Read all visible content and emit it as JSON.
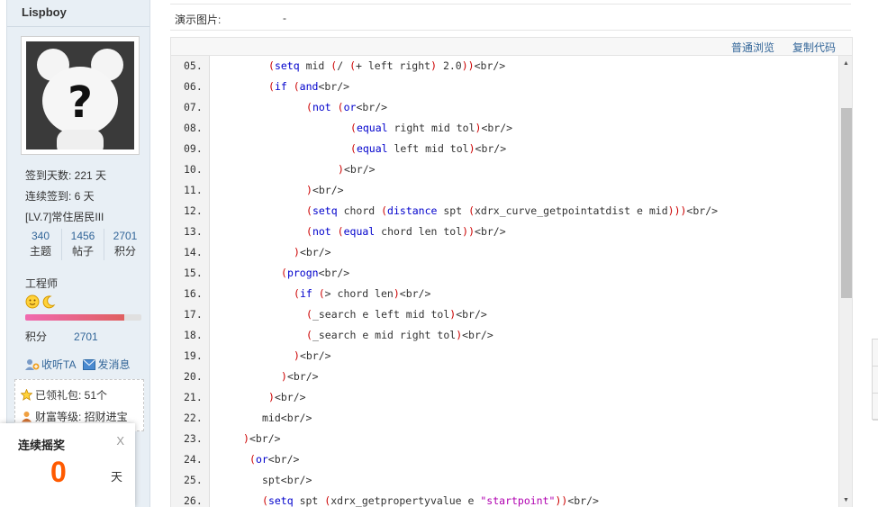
{
  "user": {
    "name": "Lispboy",
    "sign_days": "签到天数: 221 天",
    "streak_days": "连续签到: 6 天",
    "level": "[LV.7]常住居民III",
    "stats": [
      {
        "num": "340",
        "label": "主题"
      },
      {
        "num": "1456",
        "label": "帖子"
      },
      {
        "num": "2701",
        "label": "积分"
      }
    ],
    "title": "工程师",
    "credit_progress": 0.85,
    "credit_label": "积分",
    "credit_value": "2701",
    "actions": {
      "follow": "收听TA",
      "message": "发消息"
    },
    "gift": "已领礼包: 51个",
    "wealth": "财富等级: 招财进宝"
  },
  "lottery": {
    "title": "连续摇奖",
    "close": "X",
    "count": "0",
    "unit": "天"
  },
  "demo": {
    "label": "演示图片:",
    "value": "-"
  },
  "code_tools": {
    "plain_view": "普通浏览",
    "copy_code": "复制代码"
  },
  "code_lines": [
    {
      "num": "05.",
      "indent": 4,
      "html": "<span class='p'>(</span><span class='k'>setq</span> mid <span class='p'>(</span>/ <span class='p'>(</span>+ left right<span class='p'>)</span> 2.0<span class='p'>))</span>&lt;br/&gt;"
    },
    {
      "num": "06.",
      "indent": 4,
      "html": "<span class='p'>(</span><span class='k'>if</span> <span class='p'>(</span><span class='k'>and</span>&lt;br/&gt;"
    },
    {
      "num": "07.",
      "indent": 7,
      "html": "<span class='p'>(</span><span class='k'>not</span> <span class='p'>(</span><span class='k'>or</span>&lt;br/&gt;"
    },
    {
      "num": "08.",
      "indent": 10.5,
      "html": "<span class='p'>(</span><span class='k'>equal</span> right mid tol<span class='p'>)</span>&lt;br/&gt;"
    },
    {
      "num": "09.",
      "indent": 10.5,
      "html": "<span class='p'>(</span><span class='k'>equal</span> left mid tol<span class='p'>)</span>&lt;br/&gt;"
    },
    {
      "num": "10.",
      "indent": 9.5,
      "html": "<span class='p'>)</span>&lt;br/&gt;"
    },
    {
      "num": "11.",
      "indent": 7,
      "html": "<span class='p'>)</span>&lt;br/&gt;"
    },
    {
      "num": "12.",
      "indent": 7,
      "html": "<span class='p'>(</span><span class='k'>setq</span> chord <span class='p'>(</span><span class='k'>distance</span> spt <span class='p'>(</span>xdrx_curve_getpointatdist e mid<span class='p'>)))</span>&lt;br/&gt;"
    },
    {
      "num": "13.",
      "indent": 7,
      "html": "<span class='p'>(</span><span class='k'>not</span> <span class='p'>(</span><span class='k'>equal</span> chord len tol<span class='p'>))</span>&lt;br/&gt;"
    },
    {
      "num": "14.",
      "indent": 6,
      "html": "<span class='p'>)</span>&lt;br/&gt;"
    },
    {
      "num": "15.",
      "indent": 5,
      "html": "<span class='p'>(</span><span class='k'>progn</span>&lt;br/&gt;"
    },
    {
      "num": "16.",
      "indent": 6,
      "html": "<span class='p'>(</span><span class='k'>if</span> <span class='p'>(</span>&gt; chord len<span class='p'>)</span>&lt;br/&gt;"
    },
    {
      "num": "17.",
      "indent": 7,
      "html": "<span class='p'>(</span>_search e left mid tol<span class='p'>)</span>&lt;br/&gt;"
    },
    {
      "num": "18.",
      "indent": 7,
      "html": "<span class='p'>(</span>_search e mid right tol<span class='p'>)</span>&lt;br/&gt;"
    },
    {
      "num": "19.",
      "indent": 6,
      "html": "<span class='p'>)</span>&lt;br/&gt;"
    },
    {
      "num": "20.",
      "indent": 5,
      "html": "<span class='p'>)</span>&lt;br/&gt;"
    },
    {
      "num": "21.",
      "indent": 4,
      "html": "<span class='p'>)</span>&lt;br/&gt;"
    },
    {
      "num": "22.",
      "indent": 3.5,
      "html": "mid&lt;br/&gt;"
    },
    {
      "num": "23.",
      "indent": 2,
      "html": "<span class='p'>)</span>&lt;br/&gt;"
    },
    {
      "num": "24.",
      "indent": 2.5,
      "html": "<span class='p'>(</span><span class='k'>or</span>&lt;br/&gt;"
    },
    {
      "num": "25.",
      "indent": 3.5,
      "html": "spt&lt;br/&gt;"
    },
    {
      "num": "26.",
      "indent": 3.5,
      "html": "<span class='p'>(</span><span class='k'>setq</span> spt <span class='p'>(</span>xdrx_getpropertyvalue e <span class='s'>\"startpoint\"</span><span class='p'>))</span>&lt;br/&gt;"
    }
  ]
}
